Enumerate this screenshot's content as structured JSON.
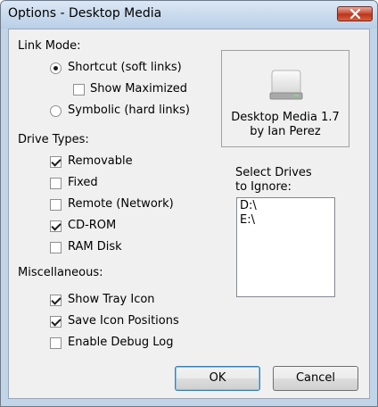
{
  "window": {
    "title": "Options - Desktop Media"
  },
  "link_mode": {
    "heading": "Link Mode:",
    "shortcut_label": "Shortcut (soft links)",
    "shortcut_selected": true,
    "show_maximized_label": "Show Maximized",
    "show_maximized_checked": false,
    "symbolic_label": "Symbolic (hard links)",
    "symbolic_selected": false
  },
  "info": {
    "app_icon": "drive-icon",
    "line1": "Desktop Media 1.7",
    "line2": "by Ian Perez"
  },
  "drive_types": {
    "heading": "Drive Types:",
    "items": [
      {
        "label": "Removable",
        "checked": true
      },
      {
        "label": "Fixed",
        "checked": false
      },
      {
        "label": "Remote (Network)",
        "checked": false
      },
      {
        "label": "CD-ROM",
        "checked": true
      },
      {
        "label": "RAM Disk",
        "checked": false
      }
    ]
  },
  "ignore_drives": {
    "label_line1": "Select Drives",
    "label_line2": "to Ignore:",
    "items": [
      "D:\\",
      "E:\\"
    ]
  },
  "miscellaneous": {
    "heading": "Miscellaneous:",
    "items": [
      {
        "label": "Show Tray Icon",
        "checked": true
      },
      {
        "label": "Save Icon Positions",
        "checked": true
      },
      {
        "label": "Enable Debug Log",
        "checked": false
      }
    ]
  },
  "buttons": {
    "ok_label": "OK",
    "cancel_label": "Cancel"
  },
  "colors": {
    "title_bar": "#c2d4e8",
    "close_button": "#c8462f",
    "dialog_bg": "#f0f0f0",
    "default_button_border": "#3c7fb1"
  }
}
